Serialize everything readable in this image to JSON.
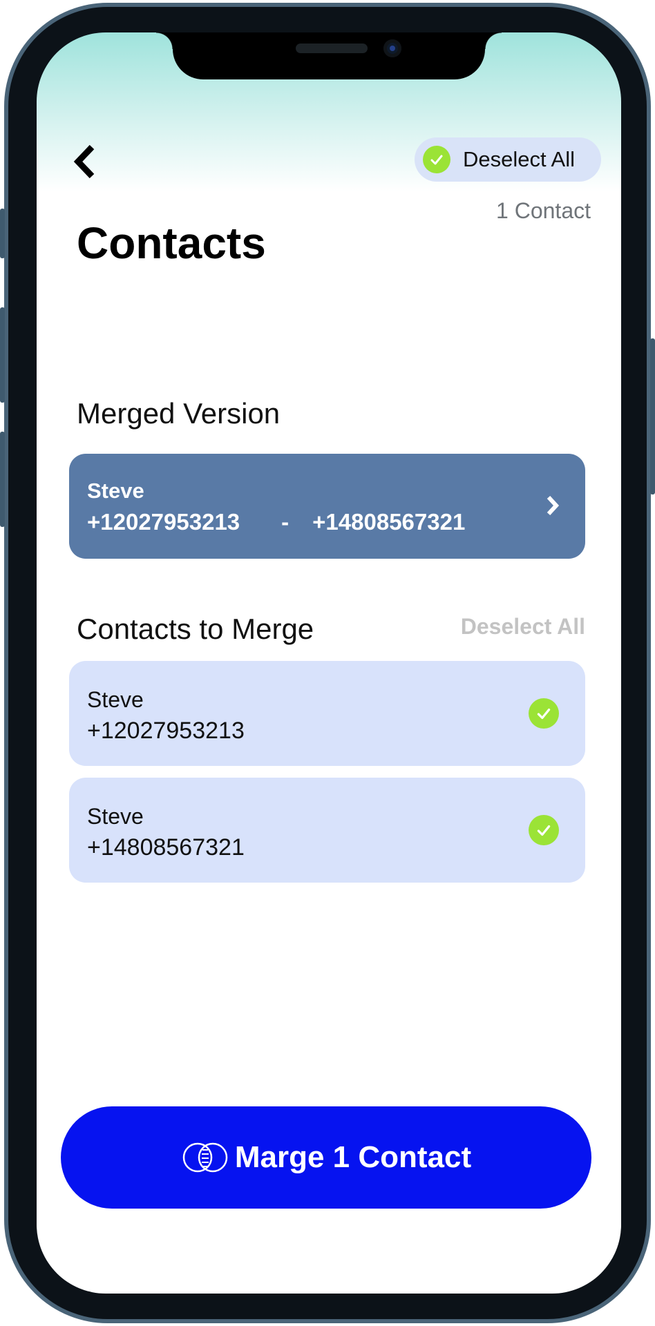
{
  "header": {
    "back_icon": "chevron-left-icon",
    "deselect_all_label": "Deselect All",
    "count_label": "1 Contact",
    "title": "Contacts"
  },
  "merged": {
    "section_title": "Merged Version",
    "name": "Steve",
    "phone_1": "+12027953213",
    "separator": "-",
    "phone_2": "+14808567321"
  },
  "to_merge": {
    "section_title": "Contacts to Merge",
    "deselect_all_label": "Deselect All",
    "items": [
      {
        "name": "Steve",
        "phone": "+12027953213",
        "selected": true
      },
      {
        "name": "Steve",
        "phone": "+14808567321",
        "selected": true
      }
    ]
  },
  "action": {
    "merge_label": "Marge 1 Contact",
    "icon": "merge-circles-icon"
  },
  "colors": {
    "accent_blue": "#0613f0",
    "merged_card": "#597aa6",
    "check_green": "#9be336",
    "card_bg": "#d8e2fb"
  }
}
